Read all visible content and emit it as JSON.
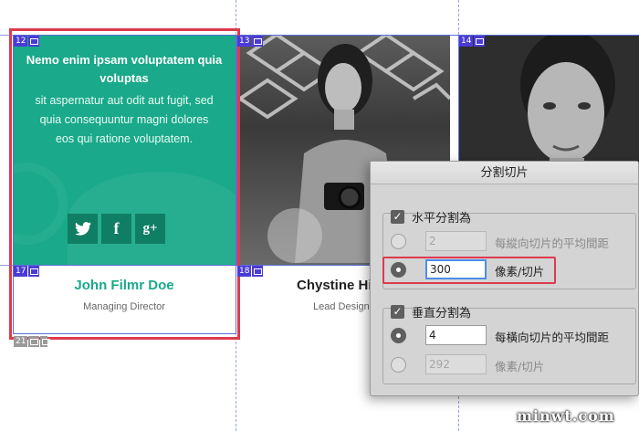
{
  "card": {
    "title": "Nemo enim ipsam voluptatem quia voluptas",
    "body": "sit aspernatur aut odit aut fugit, sed quia consequuntur magni dolores eos qui ratione voluptatem.",
    "socials": [
      {
        "icon": "twitter-icon",
        "glyph": "t"
      },
      {
        "icon": "facebook-icon",
        "glyph": "f"
      },
      {
        "icon": "google-plus-icon",
        "glyph": "g+"
      }
    ]
  },
  "people": [
    {
      "name": "John Filmr Doe",
      "role": "Managing Director"
    },
    {
      "name": "Chystine Hi",
      "role": "Lead Design"
    }
  ],
  "slices": [
    "12",
    "13",
    "14",
    "17",
    "18",
    "21"
  ],
  "dialog": {
    "title": "分割切片",
    "horizontal": {
      "label": "水平分割為",
      "checked": true,
      "opt1_value": "2",
      "opt1_label": "每縱向切片的平均間距",
      "opt2_value": "300",
      "opt2_label": "像素/切片",
      "selected": 2
    },
    "vertical": {
      "label": "垂直分割為",
      "checked": true,
      "opt1_value": "4",
      "opt1_label": "每橫向切片的平均間距",
      "opt2_value": "292",
      "opt2_label": "像素/切片",
      "selected": 1
    }
  },
  "watermark": "minwt.com",
  "colors": {
    "teal": "#1aa98a",
    "slice": "#4b3bd6",
    "highlight": "#dd3a4d"
  }
}
